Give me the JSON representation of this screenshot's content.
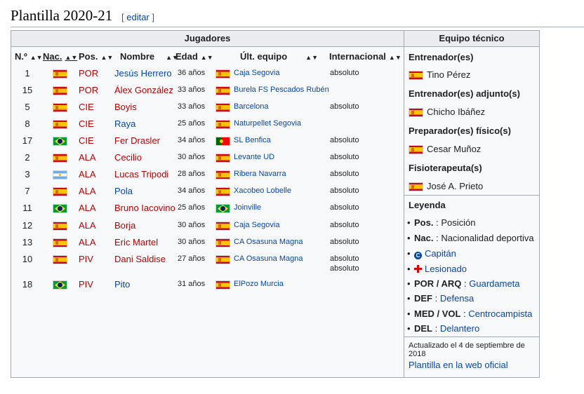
{
  "heading": {
    "title": "Plantilla 2020-21",
    "edit_open": "[ ",
    "edit_label": "editar",
    "edit_close": " ]"
  },
  "players": {
    "title": "Jugadores",
    "columns": [
      "N.º",
      "Nac.",
      "Pos.",
      "Nombre",
      "Edad",
      "Últ. equipo",
      "Internacional"
    ],
    "rows": [
      {
        "num": "1",
        "flag": "es",
        "pos": "POR",
        "name": "Jesús Herrero",
        "name_color": "blue",
        "age": "36 años",
        "club_flag": "es",
        "club": "Caja Segovia",
        "intl": "absoluto"
      },
      {
        "num": "15",
        "flag": "es",
        "pos": "POR",
        "name": "Álex González",
        "name_color": "red",
        "age": "33 años",
        "club_flag": "es",
        "club": "Burela FS Pescados Rubén",
        "intl": ""
      },
      {
        "num": "5",
        "flag": "es",
        "pos": "CIE",
        "name": "Boyis",
        "name_color": "red",
        "age": "33 años",
        "club_flag": "es",
        "club": "Barcelona",
        "intl": "absoluto"
      },
      {
        "num": "8",
        "flag": "es",
        "pos": "CIE",
        "name": "Raya",
        "name_color": "blue",
        "age": "25 años",
        "club_flag": "es",
        "club": "Naturpellet Segovia",
        "intl": ""
      },
      {
        "num": "17",
        "flag": "br",
        "pos": "CIE",
        "name": "Fer Drasler",
        "name_color": "red",
        "age": "34 años",
        "club_flag": "pt",
        "club": "SL Benfica",
        "intl": "absoluto"
      },
      {
        "num": "2",
        "flag": "es",
        "pos": "ALA",
        "name": "Cecilio",
        "name_color": "red",
        "age": "30 años",
        "club_flag": "es",
        "club": "Levante UD",
        "intl": "absoluto"
      },
      {
        "num": "3",
        "flag": "ar",
        "pos": "ALA",
        "name": "Lucas Tripodi",
        "name_color": "red",
        "age": "28 años",
        "club_flag": "es",
        "club": "Ribera Navarra",
        "intl": "absoluto"
      },
      {
        "num": "7",
        "flag": "es",
        "pos": "ALA",
        "name": "Pola",
        "name_color": "blue",
        "age": "34 años",
        "club_flag": "es",
        "club": "Xacobeo Lobelle",
        "intl": "absoluto"
      },
      {
        "num": "11",
        "flag": "br",
        "pos": "ALA",
        "name": "Bruno Iacovino",
        "name_color": "red",
        "age": "25 años",
        "club_flag": "br",
        "club": "Joinville",
        "intl": "absoluto"
      },
      {
        "num": "12",
        "flag": "es",
        "pos": "ALA",
        "name": "Borja",
        "name_color": "red",
        "age": "30 años",
        "club_flag": "es",
        "club": "Caja Segovia",
        "intl": "absoluto"
      },
      {
        "num": "13",
        "flag": "es",
        "pos": "ALA",
        "name": "Eric Martel",
        "name_color": "red",
        "age": "30 años",
        "club_flag": "es",
        "club": "CA Osasuna Magna",
        "intl": "absoluto"
      },
      {
        "num": "10",
        "flag": "es",
        "pos": "PIV",
        "name": "Dani Saldise",
        "name_color": "red",
        "age": "27 años",
        "club_flag": "es",
        "club": "CA Osasuna Magna",
        "intl": "absoluto"
      },
      {
        "num": "18",
        "flag": "br",
        "pos": "PIV",
        "name": "Pito",
        "name_color": "blue",
        "age": "31 años",
        "club_flag": "es",
        "club": "ElPozo Murcia",
        "intl": "absoluto"
      }
    ]
  },
  "staff": {
    "title": "Equipo técnico",
    "sections": [
      {
        "role": "Entrenador(es)",
        "flag": "es",
        "person": "Tino Pérez"
      },
      {
        "role": "Entrenador(es) adjunto(s)",
        "flag": "es",
        "person": "Chicho Ibáñez"
      },
      {
        "role": "Preparador(es) físico(s)",
        "flag": "es",
        "person": "Cesar Muñoz"
      },
      {
        "role": "Fisioterapeuta(s)",
        "flag": "es",
        "person": "José A. Prieto"
      }
    ],
    "legend_title": "Leyenda",
    "legend": {
      "pos_key": "Pos.",
      "pos_text": ": Posición",
      "nac_key": "Nac.",
      "nac_text": ": Nacionalidad deportiva",
      "captain": "Capitán",
      "injured": "Lesionado",
      "por_key": "POR / ARQ",
      "por_sep": " : ",
      "por_val": "Guardameta",
      "def_key": "DEF",
      "def_sep": " : ",
      "def_val": "Defensa",
      "med_key": "MED / VOL",
      "med_sep": " : ",
      "med_val": "Centrocampista",
      "del_key": "DEL",
      "del_sep": " : ",
      "del_val": "Delantero"
    },
    "updated": "Actualizado el 4 de septiembre de 2018",
    "official_link": "Plantilla en la web oficial"
  },
  "colors": {
    "link_blue": "#0645ad",
    "link_red": "#ba0000",
    "border": "#a2a9b1",
    "header_bg": "#eaecf0"
  }
}
